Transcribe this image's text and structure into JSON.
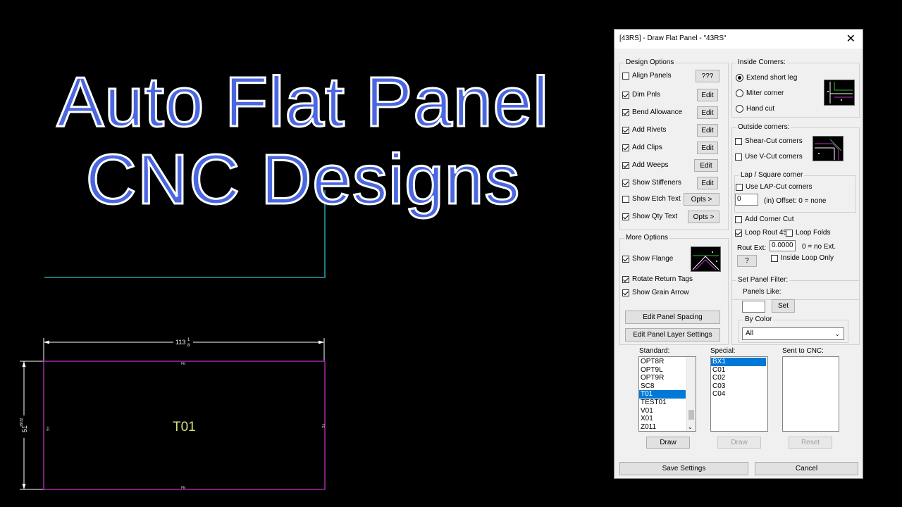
{
  "overlay": {
    "line1": "Auto Flat Panel",
    "line2": "CNC Designs"
  },
  "drawing": {
    "width_dim": "113",
    "width_frac_num": "1",
    "width_frac_den": "8",
    "height_dim": "51",
    "height_frac": "29/32",
    "panel_label": "T01",
    "edge_tag": "FE",
    "colors": {
      "panel": "#c030c0",
      "cyan": "#30c0c0",
      "dim": "#ffffff",
      "label": "#d8e07a"
    }
  },
  "dialog": {
    "title": "[43RS] - Draw Flat Panel - \"43RS\"",
    "close": "✕",
    "design_options": {
      "label": "Design Options",
      "items": [
        {
          "label": "Align Panels",
          "checked": false,
          "button": "???"
        },
        {
          "label": "Dim Pnls",
          "checked": true,
          "button": "Edit"
        },
        {
          "label": "Bend Allowance",
          "checked": true,
          "button": "Edit"
        },
        {
          "label": "Add Rivets",
          "checked": true,
          "button": "Edit"
        },
        {
          "label": "Add Clips",
          "checked": true,
          "button": "Edit"
        },
        {
          "label": "Add Weeps",
          "checked": true,
          "button": "Edit"
        },
        {
          "label": "Show Stiffeners",
          "checked": true,
          "button": "Edit"
        },
        {
          "label": "Show Etch Text",
          "checked": false,
          "button": "Opts >"
        },
        {
          "label": "Show Qty Text",
          "checked": true,
          "button": "Opts >"
        }
      ]
    },
    "more_options": {
      "label": "More Options",
      "show_flange": {
        "label": "Show Flange",
        "checked": true
      },
      "rotate_return_tags": {
        "label": "Rotate Return Tags",
        "checked": true
      },
      "show_grain_arrow": {
        "label": "Show Grain Arrow",
        "checked": true
      },
      "edit_panel_spacing": "Edit Panel Spacing",
      "edit_panel_layer_settings": "Edit Panel Layer Settings"
    },
    "inside_corners": {
      "label": "Inside Corners:",
      "options": [
        {
          "label": "Extend short leg",
          "selected": true
        },
        {
          "label": "Miter corner",
          "selected": false
        },
        {
          "label": "Hand cut",
          "selected": false
        }
      ]
    },
    "outside_corners": {
      "label": "Outside corners:",
      "shear_cut": {
        "label": "Shear-Cut corners",
        "checked": false
      },
      "v_cut": {
        "label": "Use V-Cut corners",
        "checked": false
      }
    },
    "lap_square": {
      "label": "Lap / Square corner",
      "use_lap_cut": {
        "label": "Use LAP-Cut corners",
        "checked": false
      },
      "offset_value": "0",
      "offset_label": "(in) Offset: 0 = none"
    },
    "add_corner_cut": {
      "label": "Add Corner Cut",
      "checked": false
    },
    "loop_rout_45": {
      "label": "Loop Rout 45",
      "checked": true
    },
    "loop_folds": {
      "label": "Loop Folds",
      "checked": false
    },
    "rout_ext": {
      "label": "Rout Ext:",
      "value": "0.0000",
      "hint": "0 = no Ext."
    },
    "help_button": "?",
    "inside_loop_only": {
      "label": "Inside Loop Only",
      "checked": false
    },
    "panel_filter": {
      "label": "Set Panel Filter:",
      "panels_like_label": "Panels Like:",
      "panels_like_value": "",
      "set_button": "Set",
      "by_color_label": "By Color",
      "by_color_value": "All"
    },
    "lists": {
      "standard": {
        "label": "Standard:",
        "items": [
          "OPT8R",
          "OPT9L",
          "OPT9R",
          "SC8",
          "T01",
          "TEST01",
          "V01",
          "X01",
          "Z011"
        ],
        "selected": "T01"
      },
      "special": {
        "label": "Special:",
        "items": [
          "BX1",
          "C01",
          "C02",
          "C03",
          "C04"
        ],
        "selected": "BX1"
      },
      "sent": {
        "label": "Sent to CNC:",
        "items": []
      }
    },
    "draw_button": "Draw",
    "draw_special_button": "Draw",
    "reset_button": "Reset",
    "save_settings": "Save Settings",
    "cancel": "Cancel"
  }
}
